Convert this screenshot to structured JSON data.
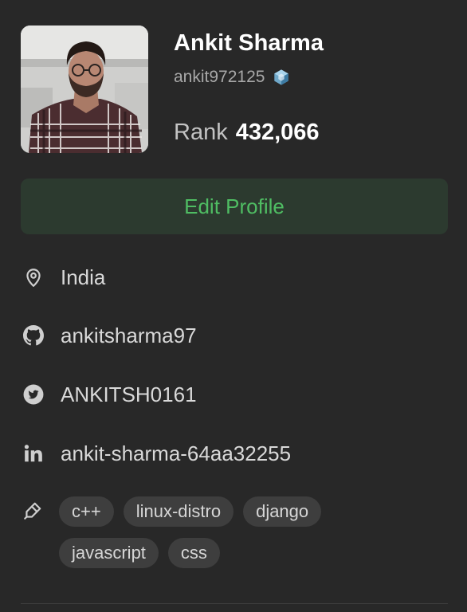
{
  "profile": {
    "name": "Ankit Sharma",
    "username": "ankit972125",
    "rank_label": "Rank",
    "rank_value": "432,066",
    "edit_label": "Edit Profile"
  },
  "info": {
    "location": "India",
    "github": "ankitsharma97",
    "twitter": "ANKITSH0161",
    "linkedin": "ankit-sharma-64aa32255"
  },
  "skills": [
    {
      "label": "c++"
    },
    {
      "label": "linux-distro"
    },
    {
      "label": "django"
    },
    {
      "label": "javascript"
    },
    {
      "label": "css"
    }
  ],
  "colors": {
    "background": "#282828",
    "accent": "#4fbd63",
    "button_bg": "#2c3a2f",
    "tag_bg": "#3e3e3e"
  },
  "icons": [
    "location-pin-icon",
    "github-icon",
    "twitter-icon",
    "linkedin-icon",
    "tag-icon",
    "hexagon-badge-icon"
  ]
}
